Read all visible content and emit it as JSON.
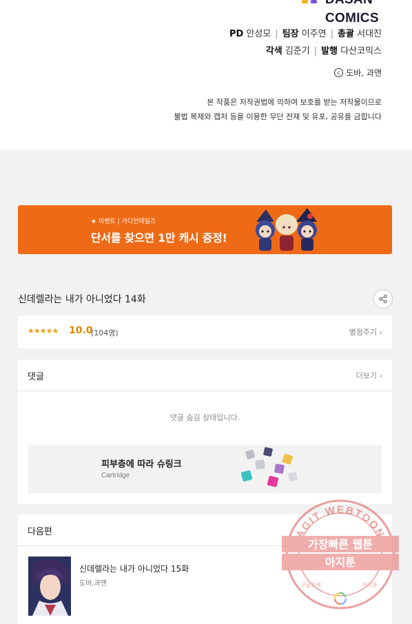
{
  "credits": {
    "logo_top": "DASAN",
    "logo_bottom": "COMICS",
    "line1": [
      {
        "role": "PD",
        "name": "안성모"
      },
      {
        "role": "팀장",
        "name": "이주연"
      },
      {
        "role": "총괄",
        "name": "서대진"
      }
    ],
    "line2": [
      {
        "role": "각색",
        "name": "김준기"
      },
      {
        "role": "발행",
        "name": "다산코믹스"
      }
    ],
    "copyright_symbol": "c",
    "copyright": "도바, 과앤",
    "notice_line1": "본 작품은 저작권법에 의하여 보호를 받는 저작물이므로",
    "notice_line2": "불법 복제와 캡처 등을 이용한 무단 전재 및 유포, 공유를 금합니다"
  },
  "banner": {
    "tag": "★ 이벤트 | 가디언테일즈",
    "title": "단서를 찾으면 1만 캐시 증정!",
    "accent": "#ee6a17"
  },
  "episode": {
    "title": "신데렐라는 내가 아니었다 14화",
    "share_icon": "share-icon"
  },
  "rating": {
    "stars": "★★★★★",
    "score": "10.0",
    "count": "(104명)",
    "rate_label": "별점주기",
    "chevron": "›"
  },
  "comments": {
    "title": "댓글",
    "more_label": "더보기",
    "chevron": "›",
    "hidden_message": "댓글 숨김 상태입니다.",
    "ad_title": "피부층에 따라 슈링크",
    "ad_subtitle": "Cartridge"
  },
  "next": {
    "title": "다음편",
    "item_title": "신데렐라는 내가 아니었다 15화",
    "item_author": "도바,과앤"
  },
  "stamp": {
    "top_text": "AGIT WEBTOON",
    "line1": "가장빠른 웹툰",
    "line2": "아지툰",
    "bottom_left": "구글검색",
    "bottom_right": "아지툰",
    "color": "#d9534f"
  }
}
